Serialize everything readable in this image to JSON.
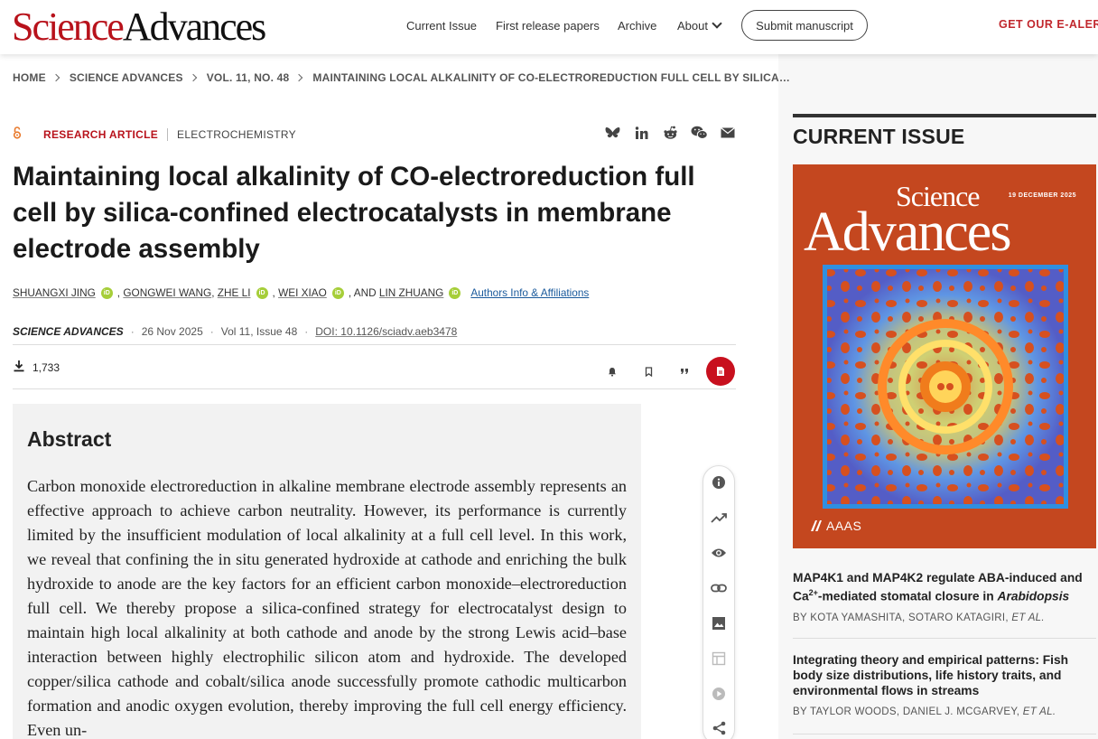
{
  "header": {
    "logo_part1": "Science",
    "logo_part2": "Advances",
    "nav": [
      "Current Issue",
      "First release papers",
      "Archive",
      "About"
    ],
    "submit_label": "Submit manuscript",
    "ealert_label": "GET OUR E-ALERT"
  },
  "breadcrumb": [
    "HOME",
    "SCIENCE ADVANCES",
    "VOL. 11, NO. 48",
    "MAINTAINING LOCAL ALKALINITY OF CO-ELECTROREDUCTION FULL CELL BY SILICA…"
  ],
  "article": {
    "type": "RESEARCH ARTICLE",
    "subject": "ELECTROCHEMISTRY",
    "title": "Maintaining local alkalinity of CO-electroreduction full cell by silica-confined electrocatalysts in membrane electrode assembly",
    "authors": [
      "SHUANGXI JING",
      "GONGWEI WANG",
      "ZHE LI",
      "WEI XIAO",
      "LIN ZHUANG"
    ],
    "author_separators": [
      ",",
      ",",
      ",",
      ", AND"
    ],
    "orcid_label": "iD",
    "affiliations_link": "Authors Info & Affiliations",
    "journal": "SCIENCE ADVANCES",
    "date": "26 Nov 2025",
    "volume_issue": "Vol 11, Issue 48",
    "doi": "DOI: 10.1126/sciadv.aeb3478",
    "downloads": "1,733"
  },
  "abstract": {
    "heading": "Abstract",
    "text": "Carbon monoxide electroreduction in alkaline membrane electrode assembly represents an effective approach to achieve carbon neutrality. However, its performance is currently limited by the insufficient modulation of local alkalinity at a full cell level. In this work, we reveal that confining the in situ generated hydroxide at cathode and enriching the bulk hydroxide to anode are the key factors for an efficient carbon monoxide–electroreduction full cell. We thereby propose a silica-confined strategy for electrocatalyst design to maintain high local alkalinity at both cathode and anode by the strong Lewis acid–base interaction between highly electrophilic silicon atom and hydroxide. The developed copper/silica cathode and cobalt/silica anode successfully promote cathodic multicarbon formation and anodic oxygen evolution, thereby improving the full cell energy efficiency. Even un-"
  },
  "sidebar": {
    "heading": "CURRENT ISSUE",
    "cover": {
      "date": "19 DECEMBER 2025",
      "title1": "Science",
      "title2": "Advances",
      "publisher": "AAAS"
    },
    "items": [
      {
        "title_pre": "MAP4K1 and MAP4K2 regulate ABA-induced and Ca",
        "title_sup": "2+",
        "title_mid": "-mediated stomatal closure in ",
        "title_italic": "Arabidopsis",
        "authors": "BY KOTA YAMASHITA, SOTARO KATAGIRI, ",
        "etal": "ET AL."
      },
      {
        "title": "Integrating theory and empirical patterns: Fish body size distributions, life history traits, and environmental flows in streams",
        "authors": "BY TAYLOR WOODS, DANIEL J. MCGARVEY, ",
        "etal": "ET AL."
      }
    ]
  },
  "colors": {
    "brand_red": "#b8121b",
    "pdf_red": "#c8101e",
    "orcid_green": "#a6ce39",
    "link_blue": "#1a5a9c",
    "cover_orange": "#c4471f"
  }
}
